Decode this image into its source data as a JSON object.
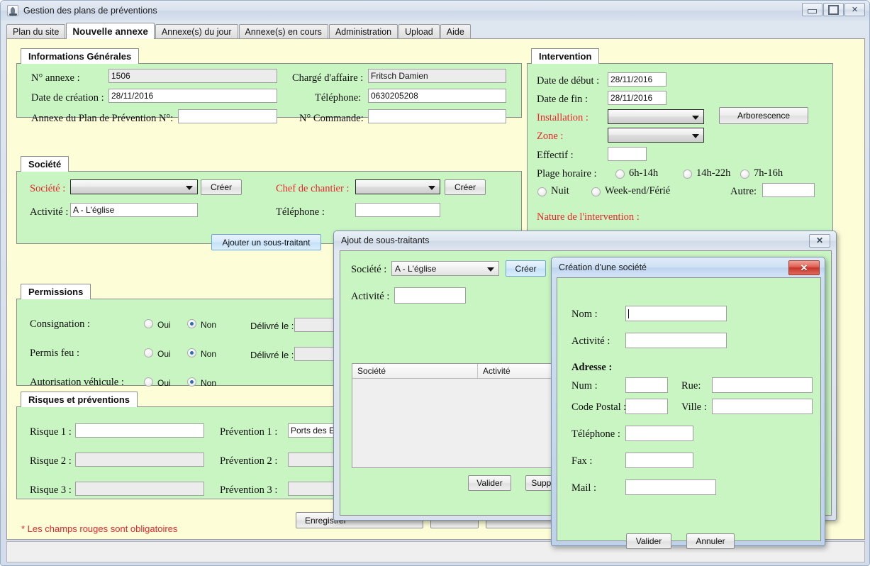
{
  "window": {
    "title": "Gestion des plans de préventions",
    "icon": "java-icon",
    "controls": {
      "minimize": "minimize-icon",
      "maximize": "maximize-icon",
      "close": "✕"
    }
  },
  "tabs": [
    {
      "label": "Plan du site",
      "active": false
    },
    {
      "label": "Nouvelle annexe",
      "active": true
    },
    {
      "label": "Annexe(s) du jour",
      "active": false
    },
    {
      "label": "Annexe(s) en cours",
      "active": false
    },
    {
      "label": "Administration",
      "active": false
    },
    {
      "label": "Upload",
      "active": false
    },
    {
      "label": "Aide",
      "active": false
    }
  ],
  "infos_generales": {
    "legend": "Informations Générales",
    "num_annexe_label": "N° annexe :",
    "num_annexe_value": "1506",
    "charge_affaire_label": "Chargé d'affaire :",
    "charge_affaire_value": "Fritsch Damien",
    "date_creation_label": "Date de création :",
    "date_creation_value": "28/11/2016",
    "telephone_label": "Téléphone:",
    "telephone_value": "0630205208",
    "annexe_pdp_label": "Annexe du Plan de Prévention N°:",
    "annexe_pdp_value": "",
    "num_commande_label": "N° Commande:",
    "num_commande_value": ""
  },
  "societe": {
    "legend": "Société",
    "societe_label": "Société :",
    "societe_value": "",
    "creer_label": "Créer",
    "chef_chantier_label": "Chef de chantier :",
    "chef_chantier_value": "",
    "creer2_label": "Créer",
    "activite_label": "Activité :",
    "activite_value": "A - L'église",
    "telephone_label": "Téléphone :",
    "telephone_value": "",
    "ajouter_sous_traitant_label": "Ajouter un sous-traitant"
  },
  "permissions": {
    "legend": "Permissions",
    "oui_label": "Oui",
    "non_label": "Non",
    "delivre_label": "Délivré le :",
    "rows": [
      {
        "label": "Consignation :",
        "oui": false,
        "non": true,
        "has_delivre": true,
        "delivre_value": ""
      },
      {
        "label": "Permis feu :",
        "oui": false,
        "non": true,
        "has_delivre": true,
        "delivre_value": ""
      },
      {
        "label": "Autorisation véhicule :",
        "oui": false,
        "non": true,
        "has_delivre": false,
        "delivre_value": ""
      }
    ]
  },
  "risques": {
    "legend": "Risques et préventions",
    "rows": [
      {
        "risque_label": "Risque 1 :",
        "risque_value": "",
        "prevention_label": "Prévention 1 :",
        "prevention_value": "Ports des EPI a"
      },
      {
        "risque_label": "Risque 2 :",
        "risque_value": "",
        "prevention_label": "Prévention 2 :",
        "prevention_value": ""
      },
      {
        "risque_label": "Risque 3 :",
        "risque_value": "",
        "prevention_label": "Prévention 3 :",
        "prevention_value": ""
      }
    ]
  },
  "footer": {
    "mandatory_note": "* Les champs rouges sont obligatoires",
    "enregistrer_label": "Enregistrer"
  },
  "intervention": {
    "legend": "Intervention",
    "date_debut_label": "Date de début :",
    "date_debut_value": "28/11/2016",
    "date_fin_label": "Date de fin :",
    "date_fin_value": "28/11/2016",
    "installation_label": "Installation :",
    "installation_value": "",
    "zone_label": "Zone :",
    "zone_value": "",
    "arborescence_label": "Arborescence",
    "effectif_label": "Effectif :",
    "effectif_value": "",
    "plage_horaire_label": "Plage horaire :",
    "plage_options": [
      {
        "label": "6h-14h",
        "selected": false
      },
      {
        "label": "14h-22h",
        "selected": false
      },
      {
        "label": "7h-16h",
        "selected": false
      },
      {
        "label": "Nuit",
        "selected": false
      },
      {
        "label": "Week-end/Férié",
        "selected": false
      }
    ],
    "autre_label": "Autre:",
    "autre_value": "",
    "nature_label": "Nature de l'intervention :"
  },
  "dialog_soustraitants": {
    "title": "Ajout de sous-traitants",
    "close_icon": "✕",
    "societe_label": "Société :",
    "societe_value": "A - L'église",
    "creer_label": "Créer",
    "activite_label": "Activité :",
    "activite_value": "",
    "table_headers": [
      "Société",
      "Activité"
    ],
    "table_rows": [],
    "valider_label": "Valider",
    "supprimer_label": "Supprimer"
  },
  "dialog_societe": {
    "title": "Création d'une société",
    "close_icon": "✕",
    "nom_label": "Nom :",
    "nom_value": "",
    "activite_label": "Activité :",
    "activite_value": "",
    "adresse_label": "Adresse :",
    "num_label": "Num :",
    "num_value": "",
    "rue_label": "Rue:",
    "rue_value": "",
    "code_postal_label": "Code Postal :",
    "code_postal_value": "",
    "ville_label": "Ville :",
    "ville_value": "",
    "telephone_label": "Téléphone :",
    "telephone_value": "",
    "fax_label": "Fax :",
    "fax_value": "",
    "mail_label": "Mail :",
    "mail_value": "",
    "valider_label": "Valider",
    "annuler_label": "Annuler"
  },
  "colors": {
    "panel_yellow": "#fdfdd8",
    "group_green": "#c9f5c3",
    "required_red": "#e8262b",
    "accent_blue": "#2a6fb5"
  }
}
